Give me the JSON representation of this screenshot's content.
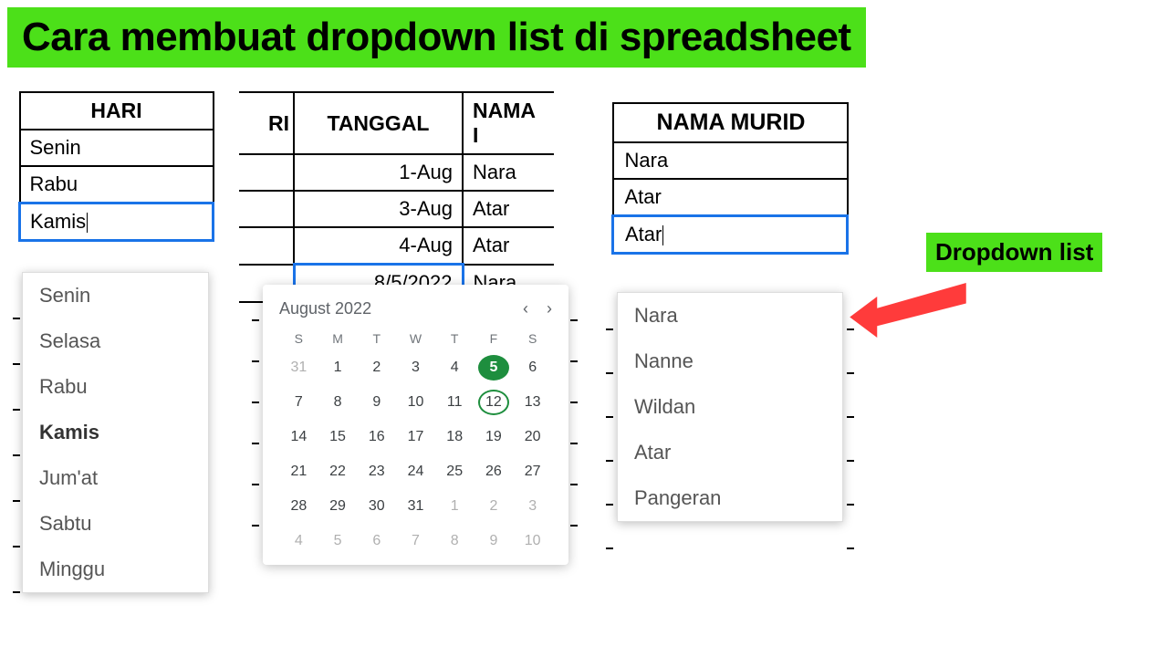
{
  "banner_title": "Cara membuat dropdown list di spreadsheet",
  "callout_label": "Dropdown list",
  "table1": {
    "header": "HARI",
    "rows": [
      "Senin",
      "Rabu",
      "Kamis"
    ],
    "selected_index": 2,
    "dropdown": [
      "Senin",
      "Selasa",
      "Rabu",
      "Kamis",
      "Jum'at",
      "Sabtu",
      "Minggu"
    ],
    "dropdown_bold_index": 3
  },
  "table2": {
    "headers": {
      "hari": "›RI",
      "tanggal": "TANGGAL",
      "nama": "NAMA ›"
    },
    "header_hari_frag": " RI",
    "header_nama_frag": "NAMA I",
    "rows": [
      {
        "tanggal": "1-Aug",
        "nama": "Nara"
      },
      {
        "tanggal": "3-Aug",
        "nama": "Atar"
      },
      {
        "tanggal": "4-Aug",
        "nama": "Atar"
      },
      {
        "tanggal": "8/5/2022",
        "nama": "Nara"
      }
    ],
    "selected_row_index": 3
  },
  "calendar": {
    "month_label": "August 2022",
    "dow": [
      "S",
      "M",
      "T",
      "W",
      "T",
      "F",
      "S"
    ],
    "cells": [
      {
        "n": "31",
        "dim": true
      },
      {
        "n": "1"
      },
      {
        "n": "2"
      },
      {
        "n": "3"
      },
      {
        "n": "4"
      },
      {
        "n": "5",
        "picked": true
      },
      {
        "n": "6"
      },
      {
        "n": "7"
      },
      {
        "n": "8"
      },
      {
        "n": "9"
      },
      {
        "n": "10"
      },
      {
        "n": "11"
      },
      {
        "n": "12",
        "today": true
      },
      {
        "n": "13"
      },
      {
        "n": "14"
      },
      {
        "n": "15"
      },
      {
        "n": "16"
      },
      {
        "n": "17"
      },
      {
        "n": "18"
      },
      {
        "n": "19"
      },
      {
        "n": "20"
      },
      {
        "n": "21"
      },
      {
        "n": "22"
      },
      {
        "n": "23"
      },
      {
        "n": "24"
      },
      {
        "n": "25"
      },
      {
        "n": "26"
      },
      {
        "n": "27"
      },
      {
        "n": "28"
      },
      {
        "n": "29"
      },
      {
        "n": "30"
      },
      {
        "n": "31"
      },
      {
        "n": "1",
        "dim": true
      },
      {
        "n": "2",
        "dim": true
      },
      {
        "n": "3",
        "dim": true
      },
      {
        "n": "4",
        "dim": true
      },
      {
        "n": "5",
        "dim": true
      },
      {
        "n": "6",
        "dim": true
      },
      {
        "n": "7",
        "dim": true
      },
      {
        "n": "8",
        "dim": true
      },
      {
        "n": "9",
        "dim": true
      },
      {
        "n": "10",
        "dim": true
      }
    ]
  },
  "table3": {
    "header": "NAMA MURID",
    "rows": [
      "Nara",
      "Atar",
      "Atar"
    ],
    "selected_index": 2,
    "dropdown": [
      "Nara",
      "Nanne",
      "Wildan",
      "Atar",
      "Pangeran"
    ]
  }
}
